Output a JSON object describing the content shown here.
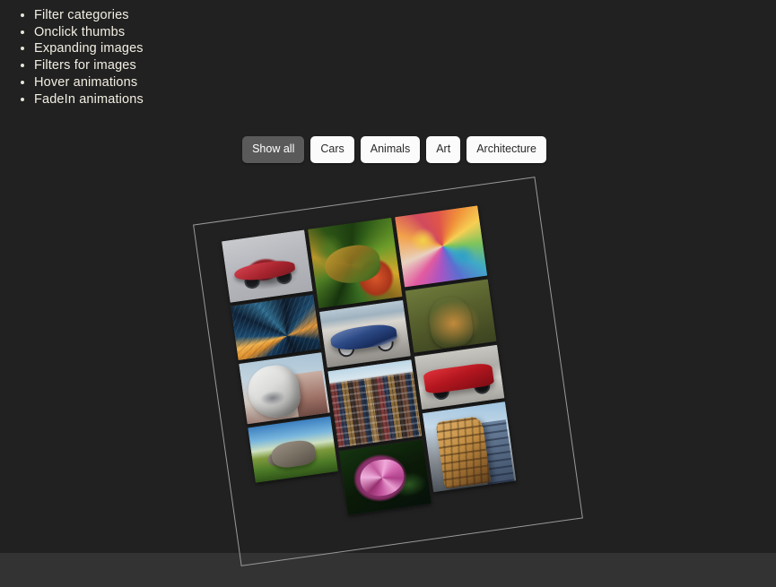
{
  "page": {
    "background_color": "#212121",
    "bottom_strip_color": "#333333"
  },
  "feature_list": {
    "items": [
      "Filter categories",
      "Onclick thumbs",
      "Expanding images",
      "Filters for images",
      "Hover animations",
      "FadeIn animations"
    ]
  },
  "filter_bar": {
    "active_color": "#5a5a5a",
    "inactive_color": "#fbfbfb",
    "buttons": [
      {
        "label": "Show all",
        "active": true
      },
      {
        "label": "Cars",
        "active": false
      },
      {
        "label": "Animals",
        "active": false
      },
      {
        "label": "Art",
        "active": false
      },
      {
        "label": "Architecture",
        "active": false
      }
    ]
  },
  "gallery": {
    "rotation_degrees": -8,
    "border_color": "#9a9a9a",
    "columns": 3,
    "items": [
      {
        "id": "car-red-convertible",
        "category": "Cars",
        "alt": "Red convertible sports car on light studio floor",
        "art_class": "art-car-red-conv",
        "aspect": "1.34",
        "column": 1
      },
      {
        "id": "abstract-skyscrapers",
        "category": "Architecture",
        "alt": "Abstract upward view of skyscrapers with orange and blue sky",
        "art_class": "art-arch-abstract",
        "aspect": "1.52",
        "column": 1
      },
      {
        "id": "stone-sculpture",
        "category": "Art",
        "alt": "White stone sculpture of a stylized face against sky",
        "art_class": "art-art-statue",
        "aspect": "1.36",
        "column": 1
      },
      {
        "id": "elephant-savanna",
        "category": "Animals",
        "alt": "Elephant walking on green grass under blue sky",
        "art_class": "art-animal-elephant",
        "aspect": "1.50",
        "column": 1
      },
      {
        "id": "chameleon-foliage",
        "category": "Animals",
        "alt": "Colorful chameleon among green leaves and orange fruit",
        "art_class": "art-animal-chameleon",
        "aspect": "1.05",
        "column": 2
      },
      {
        "id": "car-blue-sports",
        "category": "Cars",
        "alt": "Blue and silver sports car parked on a road",
        "art_class": "art-car-blue",
        "aspect": "1.48",
        "column": 2
      },
      {
        "id": "amsterdam-canal-houses",
        "category": "Architecture",
        "alt": "Row of Amsterdam canal houses with many windows",
        "art_class": "art-arch-canal",
        "aspect": "1.08",
        "column": 2
      },
      {
        "id": "pink-peony",
        "category": "Art",
        "alt": "Pink peony flower with water droplets on dark background",
        "art_class": "art-art-flower",
        "aspect": "1.30",
        "column": 2
      },
      {
        "id": "psychedelic-swirls",
        "category": "Art",
        "alt": "Psychedelic colorful swirling abstract artwork",
        "art_class": "art-art-psych",
        "aspect": "1.18",
        "column": 3
      },
      {
        "id": "cheetah-portrait",
        "category": "Animals",
        "alt": "Cheetah portrait against blurred olive background",
        "art_class": "art-animal-cheetah",
        "aspect": "1.32",
        "column": 3
      },
      {
        "id": "car-red-muscle",
        "category": "Cars",
        "alt": "Red muscle car on pale concrete",
        "art_class": "art-car-muscle",
        "aspect": "1.56",
        "column": 3
      },
      {
        "id": "gaudi-building",
        "category": "Architecture",
        "alt": "Ornate Gaudi style stone building facade",
        "art_class": "art-arch-gaudi",
        "aspect": "1.05",
        "column": 3
      }
    ]
  }
}
